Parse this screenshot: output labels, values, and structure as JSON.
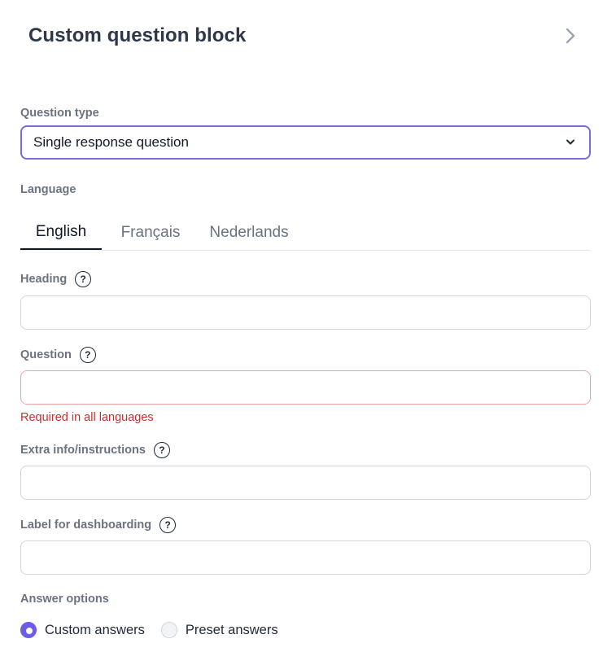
{
  "panel": {
    "title": "Custom question block"
  },
  "question_type": {
    "label": "Question type",
    "selected": "Single response question"
  },
  "language": {
    "label": "Language",
    "tabs": [
      {
        "label": "English",
        "active": true
      },
      {
        "label": "Français",
        "active": false
      },
      {
        "label": "Nederlands",
        "active": false
      }
    ]
  },
  "fields": {
    "heading": {
      "label": "Heading",
      "value": "",
      "placeholder": ""
    },
    "question": {
      "label": "Question",
      "value": "",
      "placeholder": "",
      "error": "Required in all languages"
    },
    "extra_info": {
      "label": "Extra info/instructions",
      "value": "",
      "placeholder": ""
    },
    "dashboard_label": {
      "label": "Label for dashboarding",
      "value": "",
      "placeholder": ""
    }
  },
  "help_glyph": "?",
  "answer_options": {
    "label": "Answer options",
    "options": [
      {
        "label": "Custom answers",
        "selected": true
      },
      {
        "label": "Preset answers",
        "selected": false
      }
    ]
  },
  "colors": {
    "accent": "#6c5ce7",
    "select_border": "#7c6ad8",
    "error": "#c53030",
    "error_border": "#f0a3a3"
  },
  "icons": {
    "close_panel": "chevron-right-icon",
    "dropdown": "chevron-down-icon",
    "help": "question-circle-icon"
  }
}
